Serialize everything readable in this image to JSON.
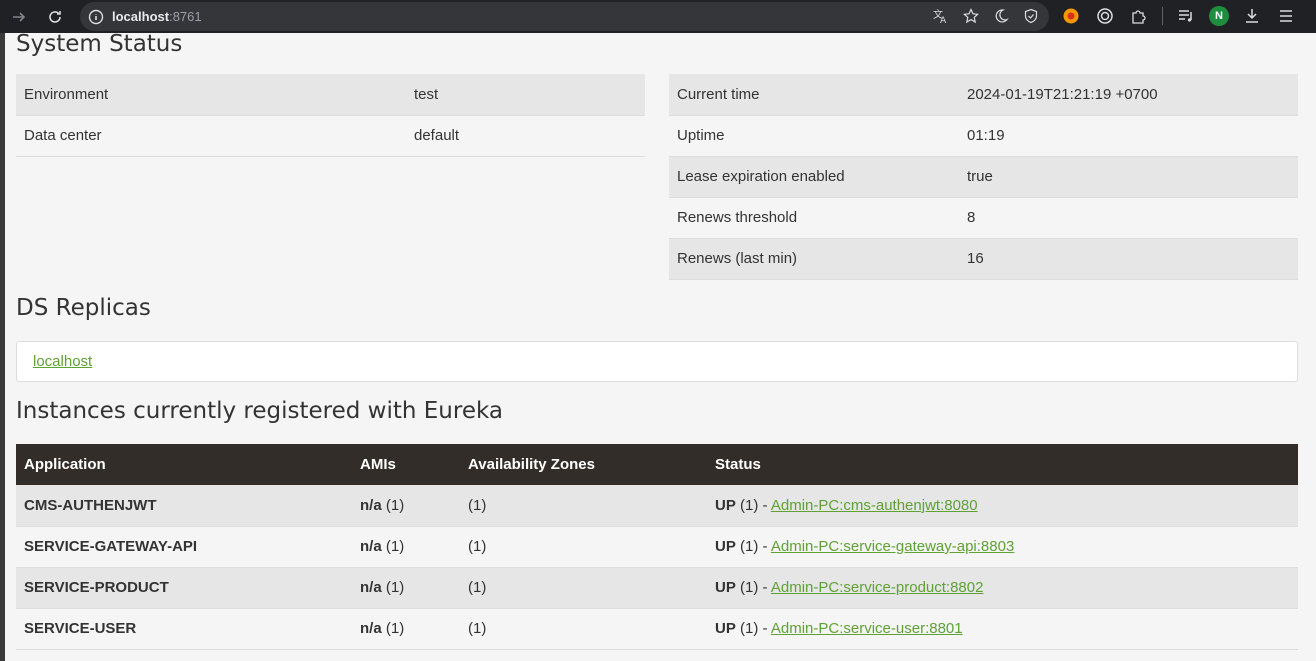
{
  "browser": {
    "url_host": "localhost",
    "url_port": ":8761",
    "profile_initial": "N"
  },
  "system_status": {
    "title": "System Status",
    "left": [
      {
        "key": "Environment",
        "value": "test"
      },
      {
        "key": "Data center",
        "value": "default"
      }
    ],
    "right": [
      {
        "key": "Current time",
        "value": "2024-01-19T21:21:19 +0700"
      },
      {
        "key": "Uptime",
        "value": "01:19"
      },
      {
        "key": "Lease expiration enabled",
        "value": "true"
      },
      {
        "key": "Renews threshold",
        "value": "8"
      },
      {
        "key": "Renews (last min)",
        "value": "16"
      }
    ]
  },
  "ds_replicas": {
    "title": "DS Replicas",
    "link": "localhost"
  },
  "instances": {
    "title": "Instances currently registered with Eureka",
    "headers": [
      "Application",
      "AMIs",
      "Availability Zones",
      "Status"
    ],
    "rows": [
      {
        "app": "CMS-AUTHENJWT",
        "ami": "n/a",
        "ami_count": "(1)",
        "zones": "(1)",
        "status": "UP",
        "status_count": "(1) -",
        "link": "Admin-PC:cms-authenjwt:8080"
      },
      {
        "app": "SERVICE-GATEWAY-API",
        "ami": "n/a",
        "ami_count": "(1)",
        "zones": "(1)",
        "status": "UP",
        "status_count": "(1) -",
        "link": "Admin-PC:service-gateway-api:8803"
      },
      {
        "app": "SERVICE-PRODUCT",
        "ami": "n/a",
        "ami_count": "(1)",
        "zones": "(1)",
        "status": "UP",
        "status_count": "(1) -",
        "link": "Admin-PC:service-product:8802"
      },
      {
        "app": "SERVICE-USER",
        "ami": "n/a",
        "ami_count": "(1)",
        "zones": "(1)",
        "status": "UP",
        "status_count": "(1) -",
        "link": "Admin-PC:service-user:8801"
      }
    ]
  }
}
